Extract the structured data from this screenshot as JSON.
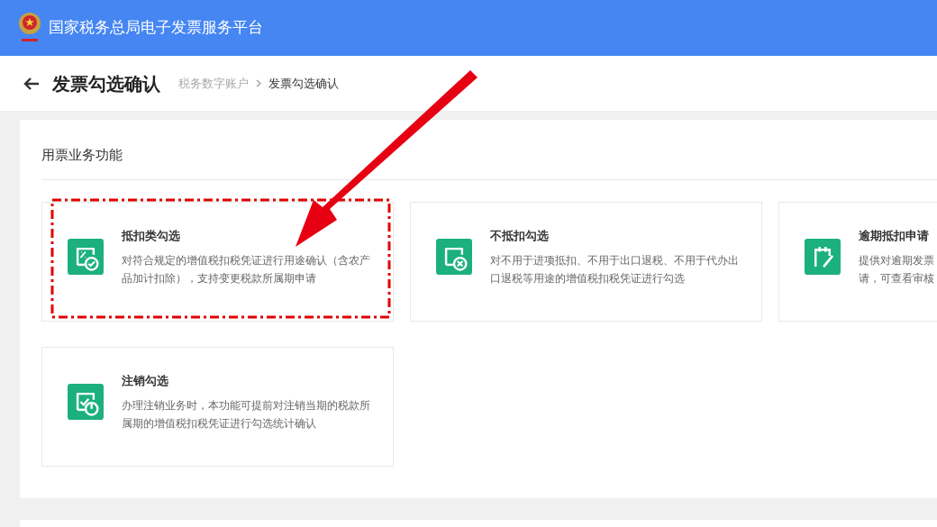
{
  "header": {
    "title": "国家税务总局电子发票服务平台"
  },
  "page": {
    "title": "发票勾选确认",
    "breadcrumb": [
      {
        "label": "税务数字账户",
        "current": false
      },
      {
        "label": "发票勾选确认",
        "current": true
      }
    ]
  },
  "section": {
    "title": "用票业务功能",
    "cards": [
      {
        "kind": "deduct",
        "title": "抵扣类勾选",
        "lines": [
          "对符合规定的增值税扣税凭证进行用途确认（含农产",
          "品加计扣除），支持变更税款所属期申请"
        ],
        "highlighted": true
      },
      {
        "kind": "nondeduct",
        "title": "不抵扣勾选",
        "lines": [
          "对不用于进项抵扣、不用于出口退税、不用于代办出",
          "口退税等用途的增值税扣税凭证进行勾选"
        ],
        "highlighted": false
      },
      {
        "kind": "overdue",
        "title": "逾期抵扣申请",
        "lines": [
          "提供对逾期发票",
          "请，可查看审核"
        ],
        "highlighted": false
      },
      {
        "kind": "cancel",
        "title": "注销勾选",
        "lines": [
          "办理注销业务时，本功能可提前对注销当期的税款所",
          "属期的增值税扣税凭证进行勾选统计确认"
        ],
        "highlighted": false
      }
    ]
  }
}
